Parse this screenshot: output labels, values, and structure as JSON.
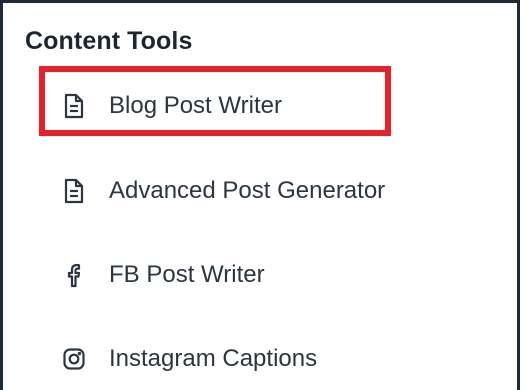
{
  "section": {
    "title": "Content Tools"
  },
  "tools": [
    {
      "label": "Blog Post Writer",
      "icon": "document-icon",
      "highlighted": true
    },
    {
      "label": "Advanced Post Generator",
      "icon": "document-icon",
      "highlighted": false
    },
    {
      "label": "FB Post Writer",
      "icon": "facebook-icon",
      "highlighted": false
    },
    {
      "label": "Instagram Captions",
      "icon": "instagram-icon",
      "highlighted": false
    }
  ],
  "colors": {
    "highlight": "#e8202a",
    "text": "#2c3640",
    "border": "#1f2a36"
  }
}
